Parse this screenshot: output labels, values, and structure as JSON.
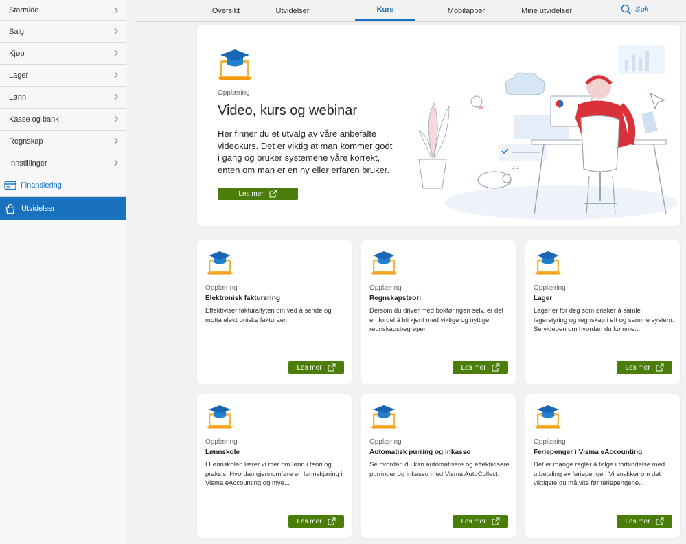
{
  "sidebar": {
    "items": [
      {
        "label": "Startside"
      },
      {
        "label": "Salg"
      },
      {
        "label": "Kjøp"
      },
      {
        "label": "Lager"
      },
      {
        "label": "Lønn"
      },
      {
        "label": "Kasse og bank"
      },
      {
        "label": "Regnskap"
      },
      {
        "label": "Innstillinger"
      }
    ],
    "financing": {
      "label": "Finansiering",
      "icon": "credit-card-icon",
      "color": "#1a7ac8"
    },
    "active": {
      "label": "Utvidelser",
      "icon": "shopping-bag-icon",
      "color": "#1a71bd"
    }
  },
  "tabs": [
    {
      "label": "Oversikt"
    },
    {
      "label": "Utvidelser"
    },
    {
      "label": "Kurs"
    },
    {
      "label": "Mobilapper"
    },
    {
      "label": "Mine utvidelser"
    }
  ],
  "search": {
    "label": "Søk",
    "icon": "search-icon"
  },
  "hero": {
    "category": "Opplæring",
    "title": "Video, kurs og webinar",
    "description": "Her finner du et utvalg av våre anbefalte videokurs. Det er viktig at man kommer godt i gang og bruker systemene våre korrekt, enten om man er en ny eller erfaren bruker.",
    "button": "Les mer",
    "icon": "graduation-cap-laptop-icon"
  },
  "cards": [
    {
      "category": "Opplæring",
      "title": "Elektronisk fakturering",
      "description": "Effektiviser fakturaflyten din ved å sende og motta elektroniske fakturaer.",
      "button": "Les mer"
    },
    {
      "category": "Opplæring",
      "title": "Regnskapsteori",
      "description": "Dersom du driver med bokføringen selv, er det en fordel å bli kjent med viktige og nyttige regnskapsbegreper.",
      "button": "Les mer"
    },
    {
      "category": "Opplæring",
      "title": "Lager",
      "description": "Lager er for deg som ønsker å samle lagerstyring og regnskap i ett og samme system. Se videoen om hvordan du komme...",
      "button": "Les mer"
    },
    {
      "category": "Opplæring",
      "title": "Lønnskole",
      "description": "I Lønnskolen lærer vi mer om lønn i teori og praksis. Hvordan gjennomføre en lønnskjøring i Visma eAccounting og mye...",
      "button": "Les mer"
    },
    {
      "category": "Opplæring",
      "title": "Automatisk purring og inkasso",
      "description": "Se hvordan du kan automatisere og effektivisere purringer og inkasso med Visma AutoCollect.",
      "button": "Les mer"
    },
    {
      "category": "Opplæring",
      "title": "Feriepenger i Visma eAccounting",
      "description": "Det er mange regler å følge i forbindelse med utbetaling av feriepenger. Vi snakker om det viktigste du må vite før feriepengene...",
      "button": "Les mer"
    }
  ],
  "colors": {
    "accent": "#1a71bd",
    "button": "#4b7d0a",
    "illustration_red": "#d9313a"
  }
}
